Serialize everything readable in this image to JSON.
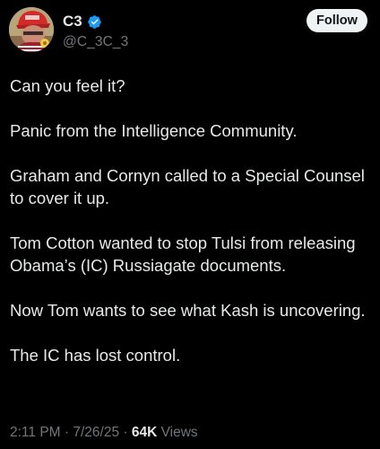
{
  "author": {
    "display_name": "C3",
    "handle": "@C_3C_3",
    "verified_color": "#1d9bf0"
  },
  "follow_label": "Follow",
  "paragraphs": [
    "Can you feel it?",
    "Panic from the Intelligence Community.",
    "Graham and Cornyn called to a Special Counsel to cover it up.",
    "Tom Cotton wanted to stop Tulsi from releasing Obama’s (IC) Russiagate documents.",
    "Now Tom wants to see what Kash is uncovering.",
    "The IC has lost control."
  ],
  "meta": {
    "time": "2:11 PM",
    "sep1": " · ",
    "date": "7/26/25",
    "sep2": " · ",
    "views_count": "64K",
    "views_label": " Views"
  }
}
